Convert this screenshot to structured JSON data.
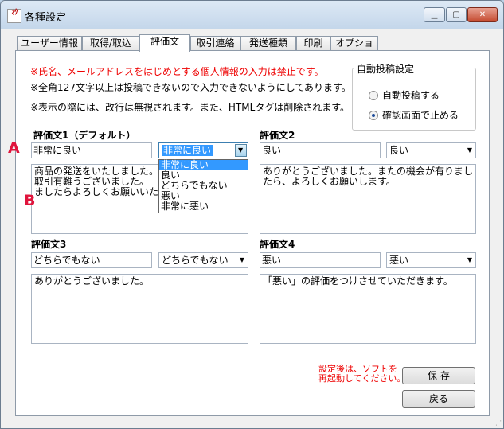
{
  "window": {
    "title": "各種設定",
    "app_icon_text": "ｵｸ",
    "minimize": "▁",
    "maximize": "▢",
    "close": "✕"
  },
  "tabs": [
    "ユーザー情報",
    "取得/取込",
    "評価文",
    "取引連絡",
    "発送種類",
    "印刷",
    "オプション"
  ],
  "active_tab": "評価文",
  "notes": {
    "privacy": "※氏名、メールアドレスをはじめとする個人情報の入力は禁止です。",
    "length": "※全角127文字以上は投稿できないので入力できないようにしてあります。",
    "display": "※表示の際には、改行は無視されます。また、HTMLタグは削除されます。"
  },
  "auto_post": {
    "title": "自動投稿設定",
    "options": [
      "自動投稿する",
      "確認画面で止める"
    ],
    "selected": "確認画面で止める"
  },
  "reviews": [
    {
      "label": "評価文1（デフォルト）",
      "title": "非常に良い",
      "rating": "非常に良い",
      "body": "商品の発送をいたしました。\n取引有難うございました。\nましたらよろしくお願いいたします。"
    },
    {
      "label": "評価文2",
      "title": "良い",
      "rating": "良い",
      "body": "ありがとうございました。またの機会が有りましたら、よろしくお願いします。"
    },
    {
      "label": "評価文3",
      "title": "どちらでもない",
      "rating": "どちらでもない",
      "body": "ありがとうございました。"
    },
    {
      "label": "評価文4",
      "title": "悪い",
      "rating": "悪い",
      "body": "「悪い」の評価をつけさせていただきます。"
    }
  ],
  "rating_options": [
    "非常に良い",
    "良い",
    "どちらでもない",
    "悪い",
    "非常に悪い"
  ],
  "dropdown_highlighted": "非常に良い",
  "annotations": {
    "a": "A",
    "b": "B"
  },
  "footer": {
    "restart_note_1": "設定後は、ソフトを",
    "restart_note_2": "再起動してください。",
    "save": "保 存",
    "back": "戻る"
  },
  "colors": {
    "warning": "#e00000",
    "highlight": "#3399ff",
    "annotation": "#e0143c"
  }
}
